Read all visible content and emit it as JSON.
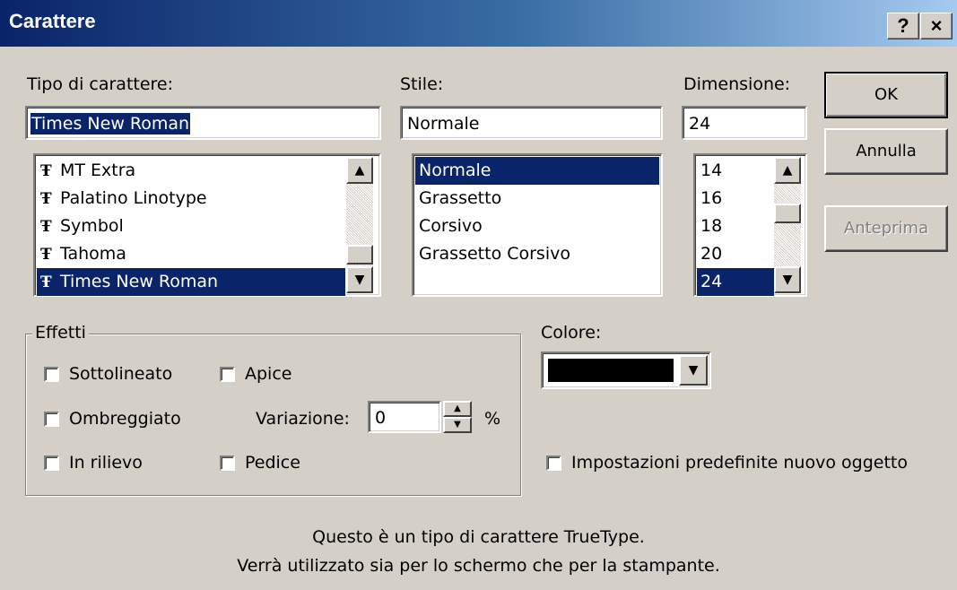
{
  "window": {
    "title": "Carattere",
    "help_button": "?",
    "close_button": "×"
  },
  "font": {
    "label": "Tipo di carattere:",
    "value": "Times New Roman",
    "items": [
      "MT Extra",
      "Palatino Linotype",
      "Symbol",
      "Tahoma",
      "Times New Roman"
    ],
    "selected_index": 4,
    "item_icon": "truetype-icon"
  },
  "style": {
    "label": "Stile:",
    "value": "Normale",
    "items": [
      "Normale",
      "Grassetto",
      "Corsivo",
      "Grassetto Corsivo"
    ],
    "selected_index": 0
  },
  "size": {
    "label": "Dimensione:",
    "value": "24",
    "items": [
      "14",
      "16",
      "18",
      "20",
      "24"
    ],
    "selected_index": 4
  },
  "buttons": {
    "ok": "OK",
    "cancel": "Annulla",
    "preview": "Anteprima"
  },
  "effects": {
    "label": "Effetti",
    "underline": "Sottolineato",
    "shadow": "Ombreggiato",
    "emboss": "In rilievo",
    "superscript": "Apice",
    "subscript": "Pedice",
    "offset_label": "Variazione:",
    "offset_value": "0",
    "offset_unit": "%"
  },
  "color": {
    "label": "Colore:",
    "value_hex": "#000000"
  },
  "default_checkbox": "Impostazioni predefinite nuovo oggetto",
  "info": {
    "line1": "Questo è un tipo di carattere TrueType.",
    "line2": "Verrà utilizzato sia per lo schermo che per la stampante."
  },
  "colors": {
    "selection": "#0a246a",
    "title_start": "#0a246a",
    "title_end": "#a6caf0",
    "face": "#d4d0c8"
  }
}
